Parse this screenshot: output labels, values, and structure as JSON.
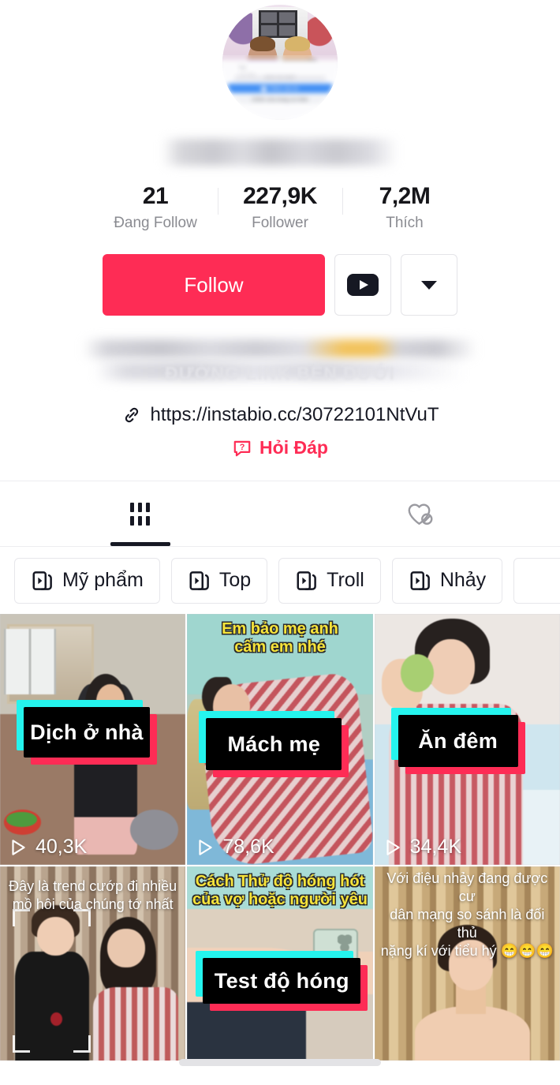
{
  "profile": {
    "avatar_alt": "profile-avatar",
    "avatar_inner": {
      "name_line1": "TO",
      "name_line2": "LÝ,TÀI",
      "grey_bar_text": "MÀN GIA ĐẸP",
      "blue_button": "Thêm vào tin",
      "blue_button_plus": "+",
      "edit_button": "Chỉnh sửa trang cá nhân"
    },
    "display_name": "",
    "stats": [
      {
        "value": "21",
        "label": "Đang Follow"
      },
      {
        "value": "227,9K",
        "label": "Follower"
      },
      {
        "value": "7,2M",
        "label": "Thích"
      }
    ],
    "actions": {
      "follow_label": "Follow",
      "youtube_icon": "youtube-icon",
      "more_icon": "chevron-down-icon"
    },
    "bio": {
      "line1": "",
      "line2": "",
      "ghost_text": "ĐƯỜNG LINK BÊN DƯỚI"
    },
    "link": {
      "icon": "link-icon",
      "url": "https://instabio.cc/30722101NtVuT"
    },
    "qa": {
      "icon": "question-bubble-icon",
      "label": "Hỏi Đáp"
    }
  },
  "tabs": [
    {
      "name": "videos",
      "icon": "grid-icon",
      "active": true
    },
    {
      "name": "liked",
      "icon": "heart-slash-icon",
      "active": false
    }
  ],
  "playlists": [
    {
      "label": "Mỹ phẩm",
      "icon": "playlist-icon"
    },
    {
      "label": "Top",
      "icon": "playlist-icon"
    },
    {
      "label": "Troll",
      "icon": "playlist-icon"
    },
    {
      "label": "Nhảy",
      "icon": "playlist-icon"
    }
  ],
  "videos": [
    {
      "caption": "Dịch ở nhà",
      "top_text": "",
      "views": "40,3K",
      "play_icon": "play-icon"
    },
    {
      "caption": "Mách mẹ",
      "top_text": "Em bảo mẹ anh\ncấm em nhé",
      "views": "78,6K",
      "play_icon": "play-icon"
    },
    {
      "caption": "Ăn đêm",
      "top_text": "",
      "views": "34,4K",
      "play_icon": "play-icon"
    },
    {
      "caption": "",
      "top_text": "Đây là trend cướp đi nhiều\nmồ hôi của chúng tớ nhất",
      "views": "",
      "play_icon": "play-icon"
    },
    {
      "caption": "Test độ hóng",
      "top_text": "Cách Thử độ hóng hót\ncủa vợ hoặc người yêu",
      "views": "",
      "play_icon": "play-icon"
    },
    {
      "caption": "",
      "top_text": "Với điệu nhảy đang được cư\ndân mạng so sánh là đối thủ\nnặng kí với tiểu hý 😁😁😁",
      "views": "",
      "play_icon": "play-icon"
    }
  ],
  "colors": {
    "brand_red": "#fe2c55",
    "brand_cyan": "#25f4ee",
    "ink": "#161823",
    "muted": "#8a8b91"
  }
}
